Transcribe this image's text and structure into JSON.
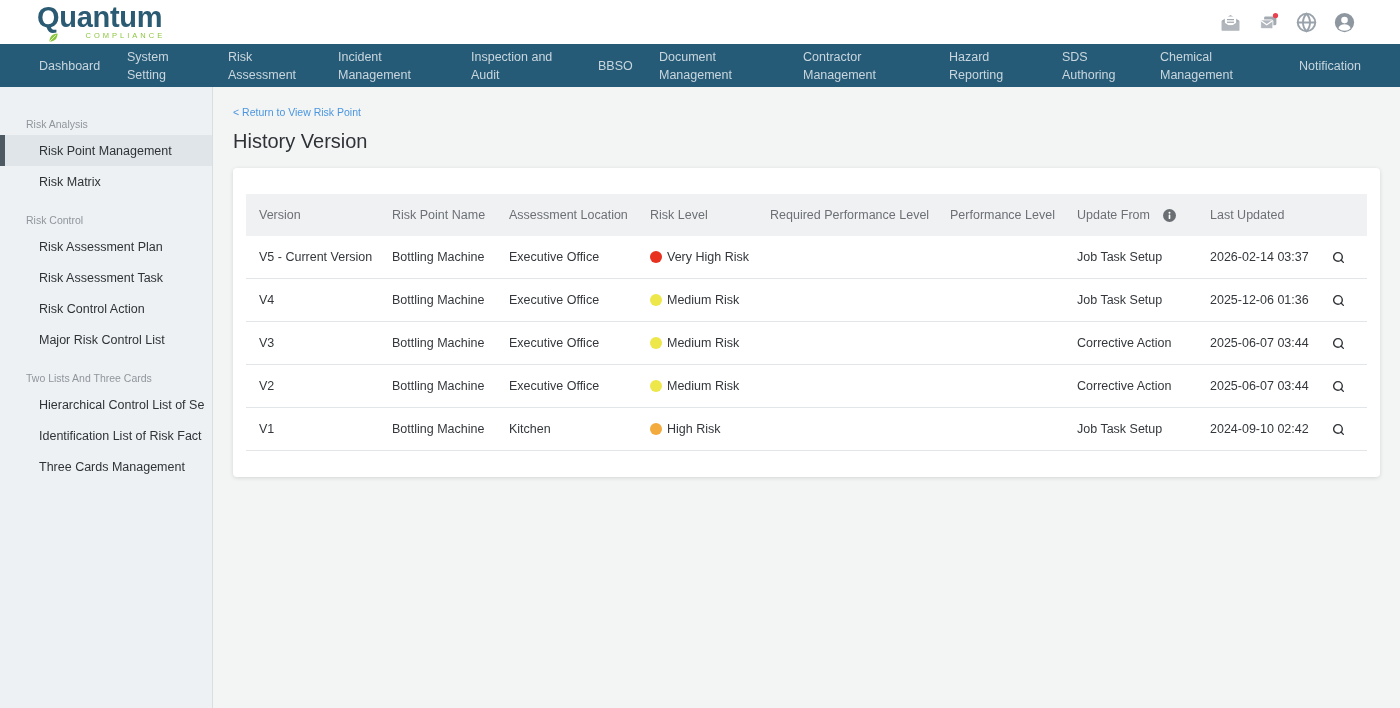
{
  "header": {
    "logo": {
      "name": "Quantum",
      "tagline": "COMPLIANCE"
    }
  },
  "nav": [
    {
      "lines": [
        "Dashboard"
      ]
    },
    {
      "lines": [
        "System",
        "Setting"
      ]
    },
    {
      "lines": [
        "Risk",
        "Assessment"
      ]
    },
    {
      "lines": [
        "Incident",
        "Management"
      ]
    },
    {
      "lines": [
        "Inspection and",
        "Audit"
      ]
    },
    {
      "lines": [
        "BBSO"
      ]
    },
    {
      "lines": [
        "Document",
        "Management"
      ]
    },
    {
      "lines": [
        "Contractor",
        "Management"
      ]
    },
    {
      "lines": [
        "Hazard",
        "Reporting"
      ]
    },
    {
      "lines": [
        "SDS",
        "Authoring"
      ]
    },
    {
      "lines": [
        "Chemical",
        "Management"
      ]
    },
    {
      "lines": [
        "Notification"
      ]
    }
  ],
  "sidebar": {
    "sections": [
      {
        "title": "Risk Analysis",
        "items": [
          {
            "label": "Risk Point Management",
            "selected": true
          },
          {
            "label": "Risk Matrix",
            "selected": false
          }
        ]
      },
      {
        "title": "Risk Control",
        "items": [
          {
            "label": "Risk Assessment Plan",
            "selected": false
          },
          {
            "label": "Risk Assessment Task",
            "selected": false
          },
          {
            "label": "Risk Control Action",
            "selected": false
          },
          {
            "label": "Major Risk Control List",
            "selected": false
          }
        ]
      },
      {
        "title": "Two Lists And Three Cards",
        "items": [
          {
            "label": "Hierarchical Control List of Se",
            "selected": false
          },
          {
            "label": "Identification List of Risk Fact",
            "selected": false
          },
          {
            "label": "Three Cards Management",
            "selected": false
          }
        ]
      }
    ]
  },
  "page": {
    "back_link": "< Return to View Risk Point",
    "title": "History Version"
  },
  "table": {
    "columns": [
      {
        "label": "Version",
        "info": false
      },
      {
        "label": "Risk Point Name",
        "info": false
      },
      {
        "label": "Assessment Location",
        "info": false
      },
      {
        "label": "Risk Level",
        "info": false
      },
      {
        "label": "Required Performance Level",
        "info": false
      },
      {
        "label": "Performance Level",
        "info": false
      },
      {
        "label": "Update From",
        "info": true
      },
      {
        "label": "Last Updated",
        "info": false
      }
    ],
    "rows": [
      {
        "version": "V5 - Current Version",
        "risk_point_name": "Bottling Machine",
        "assessment_location": "Executive Office",
        "risk_level": {
          "label": "Very High Risk",
          "color": "#e8311f"
        },
        "update_from": "Job Task Setup",
        "last_updated": "2026-02-14 03:37"
      },
      {
        "version": "V4",
        "risk_point_name": "Bottling Machine",
        "assessment_location": "Executive Office",
        "risk_level": {
          "label": "Medium Risk",
          "color": "#ede74a"
        },
        "update_from": "Job Task Setup",
        "last_updated": "2025-12-06 01:36"
      },
      {
        "version": "V3",
        "risk_point_name": "Bottling Machine",
        "assessment_location": "Executive Office",
        "risk_level": {
          "label": "Medium Risk",
          "color": "#ede74a"
        },
        "update_from": "Corrective Action",
        "last_updated": "2025-06-07 03:44"
      },
      {
        "version": "V2",
        "risk_point_name": "Bottling Machine",
        "assessment_location": "Executive Office",
        "risk_level": {
          "label": "Medium Risk",
          "color": "#ede74a"
        },
        "update_from": "Corrective Action",
        "last_updated": "2025-06-07 03:44"
      },
      {
        "version": "V1",
        "risk_point_name": "Bottling Machine",
        "assessment_location": "Kitchen",
        "risk_level": {
          "label": "High Risk",
          "color": "#f2ab3c"
        },
        "update_from": "Job Task Setup",
        "last_updated": "2024-09-10 02:42"
      }
    ]
  }
}
